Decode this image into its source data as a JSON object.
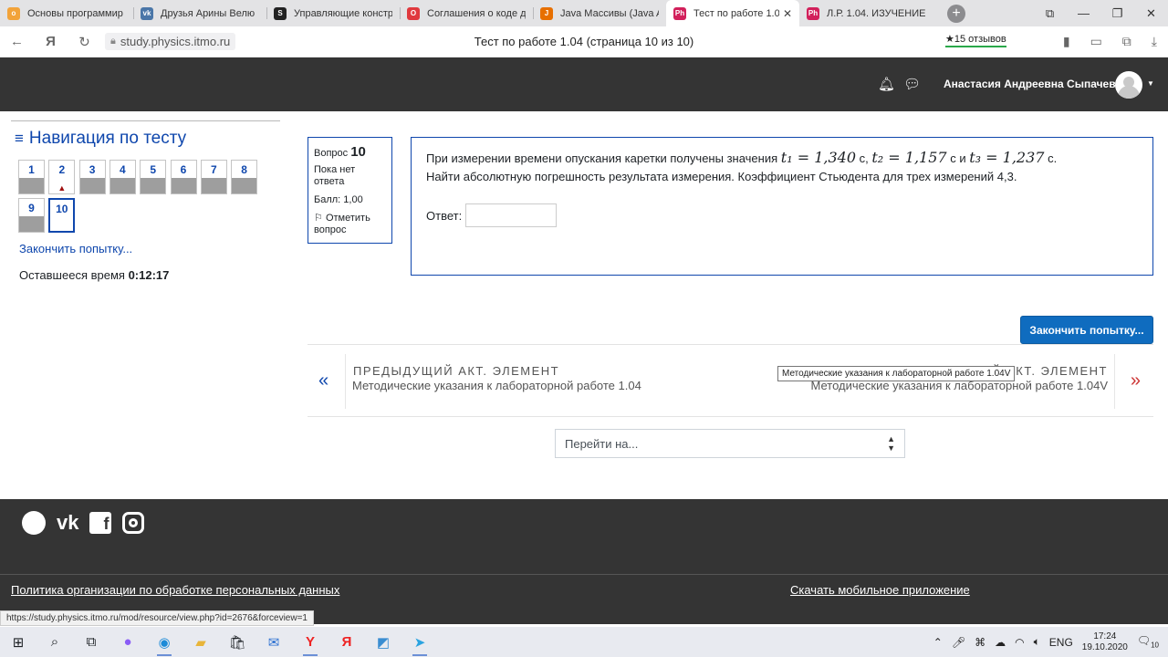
{
  "browser": {
    "tabs": [
      {
        "title": "Основы программир",
        "icon": "book-icon",
        "color": "#f2a33a",
        "glyph": "o"
      },
      {
        "title": "Друзья Арины Велю",
        "icon": "vk-icon",
        "color": "#4a76a8",
        "glyph": "vk"
      },
      {
        "title": "Управляющие констр",
        "icon": "spiral-icon",
        "color": "#222222",
        "glyph": "S"
      },
      {
        "title": "Соглашения о коде д",
        "icon": "oracle-icon",
        "color": "#e0393e",
        "glyph": "O"
      },
      {
        "title": "Java Массивы (Java A",
        "icon": "java-icon",
        "color": "#e76f00",
        "glyph": "J"
      },
      {
        "title": "Тест по работе 1.04",
        "icon": "physics-icon",
        "color": "#d2205b",
        "glyph": "Ph",
        "active": true
      },
      {
        "title": "Л.Р. 1.04. ИЗУЧЕНИЕ Р",
        "icon": "physics-icon",
        "color": "#d2205b",
        "glyph": "Ph"
      }
    ],
    "url": "study.physics.itmo.ru",
    "page_title": "Тест по работе 1.04 (страница 10 из 10)",
    "reviews": "★15 отзывов",
    "status_url": "https://study.physics.itmo.ru/mod/resource/view.php?id=2676&forceview=1"
  },
  "header": {
    "user_name": "Анастасия Андреевна Сыпачева"
  },
  "quiz_nav": {
    "title": "Навигация по тесту",
    "questions": [
      {
        "num": "1",
        "state": "answered"
      },
      {
        "num": "2",
        "state": "flagged"
      },
      {
        "num": "3",
        "state": "answered"
      },
      {
        "num": "4",
        "state": "answered"
      },
      {
        "num": "5",
        "state": "answered"
      },
      {
        "num": "6",
        "state": "answered"
      },
      {
        "num": "7",
        "state": "answered"
      },
      {
        "num": "8",
        "state": "answered"
      },
      {
        "num": "9",
        "state": "answered"
      },
      {
        "num": "10",
        "state": "current"
      }
    ],
    "finish_link": "Закончить попытку...",
    "time_label": "Оставшееся время",
    "time_value": "0:12:17"
  },
  "question_info": {
    "label": "Вопрос",
    "number": "10",
    "status": "Пока нет ответа",
    "grade": "Балл: 1,00",
    "flag": "Отметить вопрос"
  },
  "question": {
    "text_intro": "При измерении времени опускания каретки получены значения",
    "t1": "t₁ = 1,340",
    "unit1": " с,",
    "t2": "t₂ = 1,157",
    "unit2": " с и",
    "t3": "t₃ = 1,237",
    "unit3": " с.",
    "text_line2": "Найти абсолютную погрешность результата измерения. Коэффициент Стьюдента для трех измерений 4,3.",
    "answer_label": "Ответ:",
    "answer_value": ""
  },
  "finish_button": "Закончить попытку...",
  "activity_nav": {
    "prev_heading": "ПРЕДЫДУЩИЙ АКТ. ЭЛЕМЕНТ",
    "prev_link": "Методические указания к лабораторной работе 1.04",
    "next_heading": "СЛЕДУЮЩИЙ АКТ. ЭЛЕМЕНТ",
    "next_link": "Методические указания к лабораторной работе 1.04V",
    "tooltip": "Методические указания к лабораторной работе 1.04V"
  },
  "jump": {
    "placeholder": "Перейти на..."
  },
  "footer": {
    "privacy_link": "Политика организации по обработке персональных данных",
    "app_link": "Скачать мобильное приложение"
  },
  "taskbar": {
    "lang": "ENG",
    "time": "17:24",
    "date": "19.10.2020",
    "notif_count": "10"
  }
}
